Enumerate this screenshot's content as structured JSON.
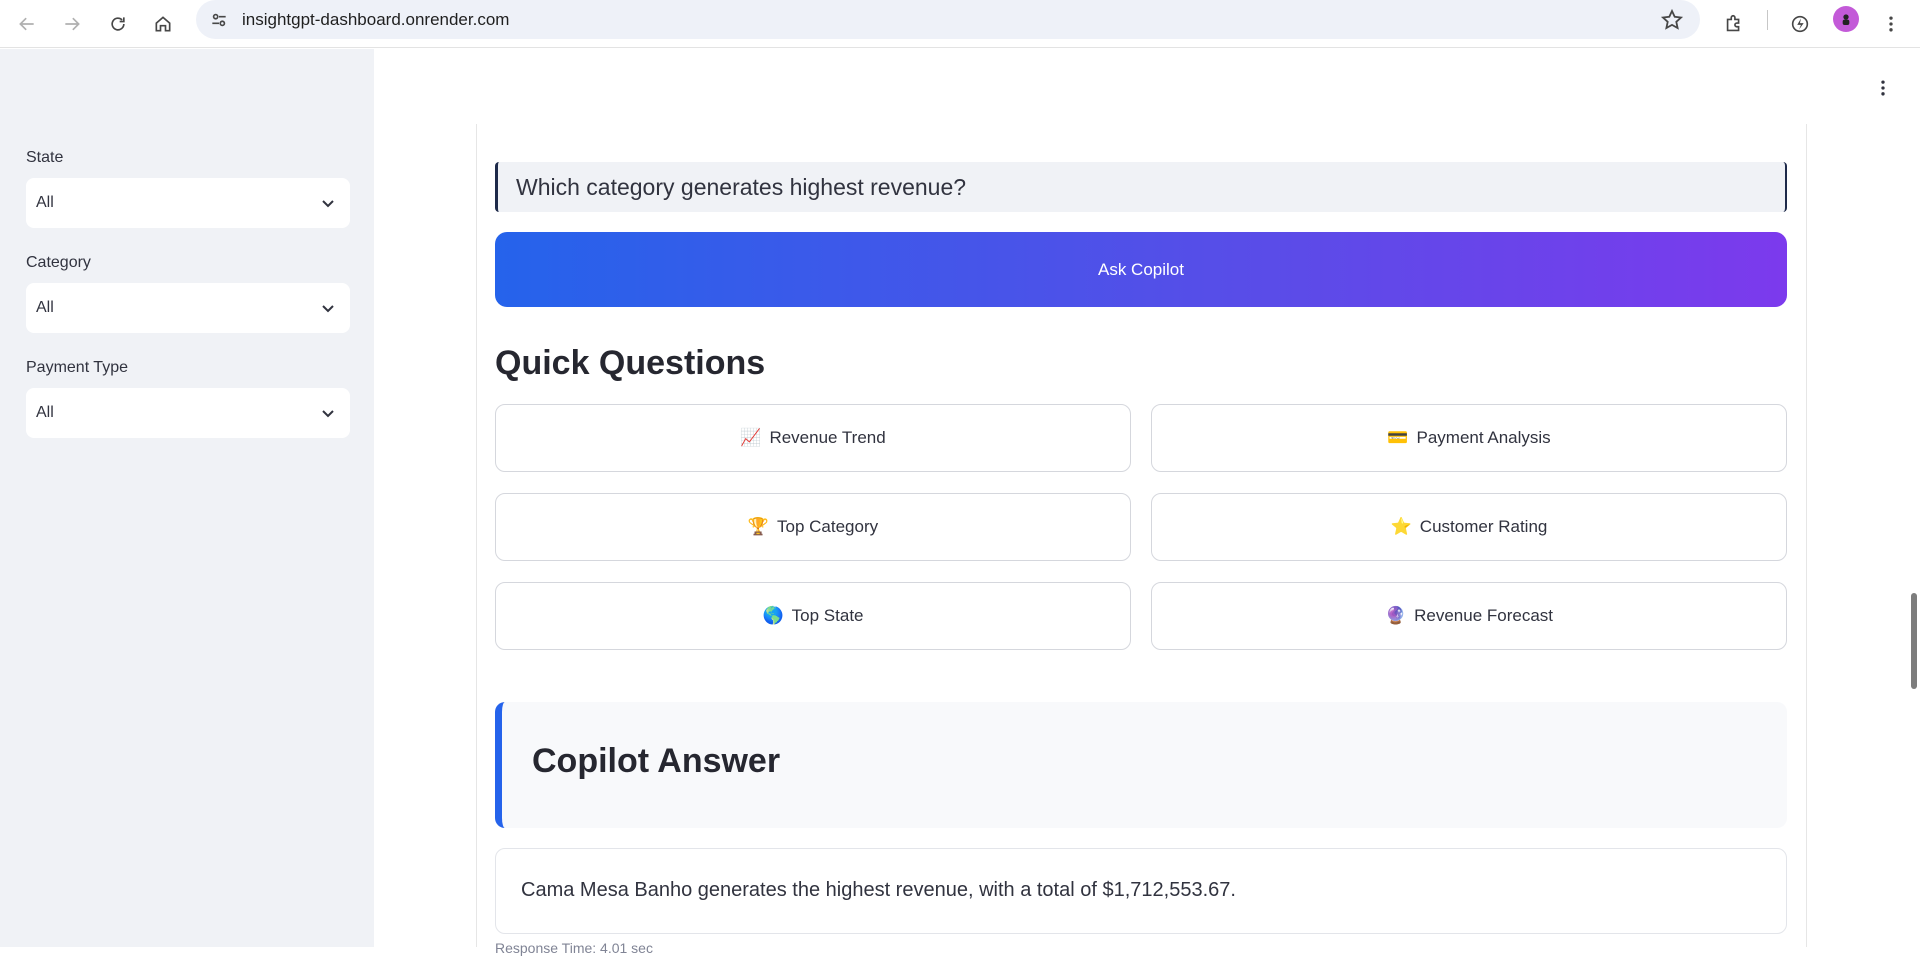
{
  "browser": {
    "url": "insightgpt-dashboard.onrender.com"
  },
  "sidebar": {
    "filters": [
      {
        "label": "State",
        "value": "All"
      },
      {
        "label": "Category",
        "value": "All"
      },
      {
        "label": "Payment Type",
        "value": "All"
      }
    ]
  },
  "main": {
    "question": "Which category generates highest revenue?",
    "ask_button": "Ask Copilot",
    "quick_questions_title": "Quick Questions",
    "quick_questions": [
      {
        "emoji": "📈",
        "label": "Revenue Trend"
      },
      {
        "emoji": "💳",
        "label": "Payment Analysis"
      },
      {
        "emoji": "🏆",
        "label": "Top Category"
      },
      {
        "emoji": "⭐",
        "label": "Customer Rating"
      },
      {
        "emoji": "🌎",
        "label": "Top State"
      },
      {
        "emoji": "🔮",
        "label": "Revenue Forecast"
      }
    ],
    "answer_title": "Copilot Answer",
    "answer_text": "Cama Mesa Banho generates the highest revenue, with a total of $1,712,553.67.",
    "response_time": "Response Time: 4.01 sec"
  },
  "colors": {
    "accent_start": "#2563eb",
    "accent_end": "#7c3aed",
    "sidebar_bg": "#f0f2f6"
  }
}
